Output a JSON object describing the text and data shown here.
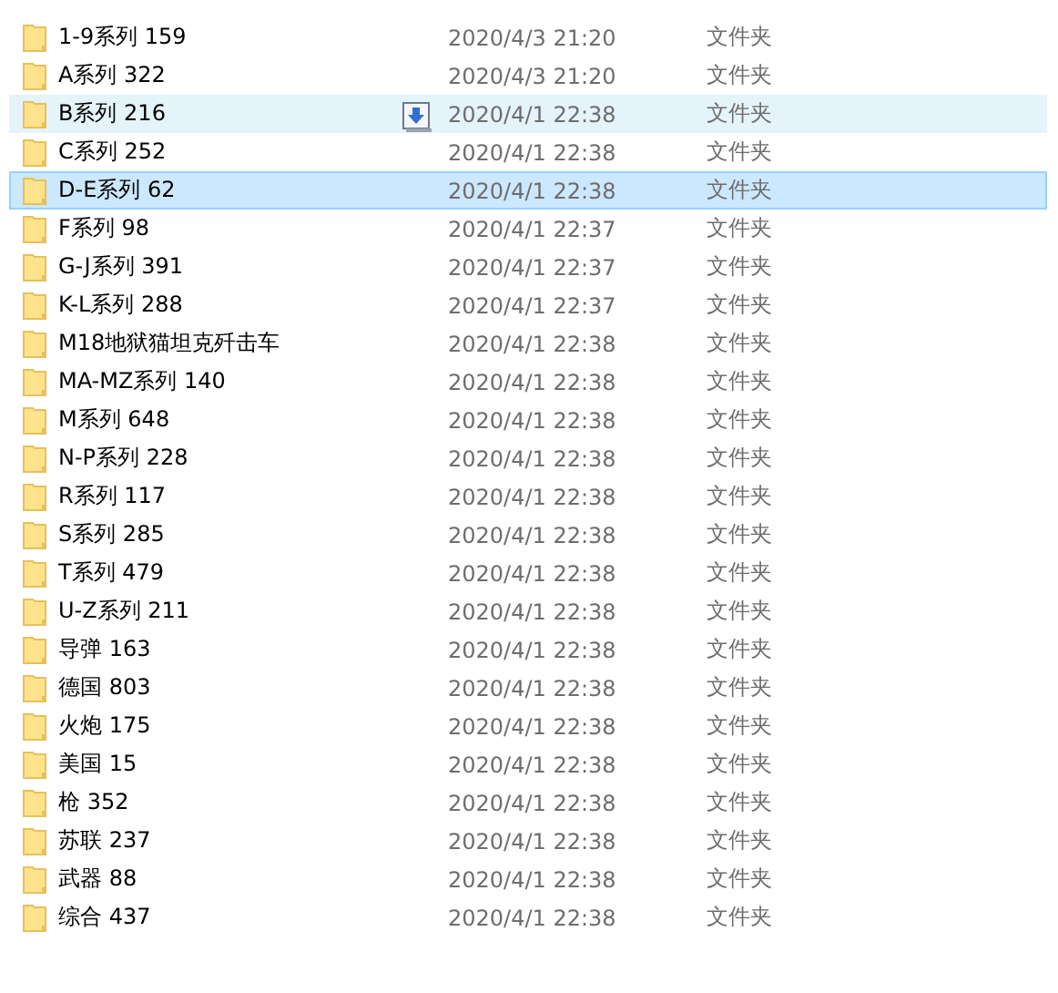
{
  "files": [
    {
      "name": "1-9系列 159",
      "modified": "2020/4/3 21:20",
      "type": "文件夹",
      "selected": false,
      "hovered": false
    },
    {
      "name": "A系列 322",
      "modified": "2020/4/3 21:20",
      "type": "文件夹",
      "selected": false,
      "hovered": false
    },
    {
      "name": "B系列 216",
      "modified": "2020/4/1 22:38",
      "type": "文件夹",
      "selected": false,
      "hovered": true
    },
    {
      "name": "C系列 252",
      "modified": "2020/4/1 22:38",
      "type": "文件夹",
      "selected": false,
      "hovered": false
    },
    {
      "name": "D-E系列 62",
      "modified": "2020/4/1 22:38",
      "type": "文件夹",
      "selected": true,
      "hovered": false
    },
    {
      "name": "F系列 98",
      "modified": "2020/4/1 22:37",
      "type": "文件夹",
      "selected": false,
      "hovered": false
    },
    {
      "name": "G-J系列 391",
      "modified": "2020/4/1 22:37",
      "type": "文件夹",
      "selected": false,
      "hovered": false
    },
    {
      "name": "K-L系列 288",
      "modified": "2020/4/1 22:37",
      "type": "文件夹",
      "selected": false,
      "hovered": false
    },
    {
      "name": "M18地狱猫坦克歼击车",
      "modified": "2020/4/1 22:38",
      "type": "文件夹",
      "selected": false,
      "hovered": false
    },
    {
      "name": "MA-MZ系列 140",
      "modified": "2020/4/1 22:38",
      "type": "文件夹",
      "selected": false,
      "hovered": false
    },
    {
      "name": "M系列 648",
      "modified": "2020/4/1 22:38",
      "type": "文件夹",
      "selected": false,
      "hovered": false
    },
    {
      "name": "N-P系列 228",
      "modified": "2020/4/1 22:38",
      "type": "文件夹",
      "selected": false,
      "hovered": false
    },
    {
      "name": "R系列 117",
      "modified": "2020/4/1 22:38",
      "type": "文件夹",
      "selected": false,
      "hovered": false
    },
    {
      "name": "S系列 285",
      "modified": "2020/4/1 22:38",
      "type": "文件夹",
      "selected": false,
      "hovered": false
    },
    {
      "name": "T系列 479",
      "modified": "2020/4/1 22:38",
      "type": "文件夹",
      "selected": false,
      "hovered": false
    },
    {
      "name": "U-Z系列 211",
      "modified": "2020/4/1 22:38",
      "type": "文件夹",
      "selected": false,
      "hovered": false
    },
    {
      "name": "导弹 163",
      "modified": "2020/4/1 22:38",
      "type": "文件夹",
      "selected": false,
      "hovered": false
    },
    {
      "name": "德国 803",
      "modified": "2020/4/1 22:38",
      "type": "文件夹",
      "selected": false,
      "hovered": false
    },
    {
      "name": "火炮 175",
      "modified": "2020/4/1 22:38",
      "type": "文件夹",
      "selected": false,
      "hovered": false
    },
    {
      "name": "美国 15",
      "modified": "2020/4/1 22:38",
      "type": "文件夹",
      "selected": false,
      "hovered": false
    },
    {
      "name": "枪 352",
      "modified": "2020/4/1 22:38",
      "type": "文件夹",
      "selected": false,
      "hovered": false
    },
    {
      "name": "苏联 237",
      "modified": "2020/4/1 22:38",
      "type": "文件夹",
      "selected": false,
      "hovered": false
    },
    {
      "name": "武器 88",
      "modified": "2020/4/1 22:38",
      "type": "文件夹",
      "selected": false,
      "hovered": false
    },
    {
      "name": "综合 437",
      "modified": "2020/4/1 22:38",
      "type": "文件夹",
      "selected": false,
      "hovered": false
    }
  ]
}
